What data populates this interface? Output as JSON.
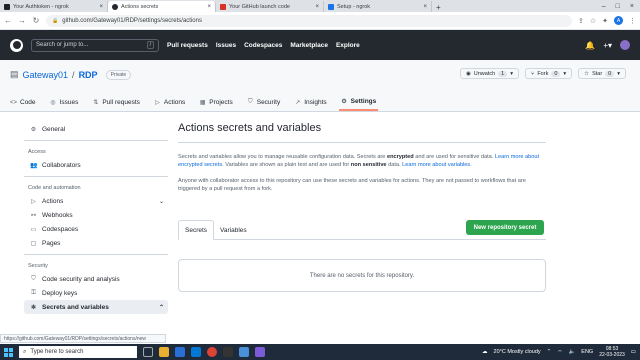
{
  "browser": {
    "tabs": [
      {
        "title": "Your Authtoken - ngrok",
        "color": "#1f2328"
      },
      {
        "title": "Actions secrets",
        "color": "#24292f"
      },
      {
        "title": "Your GitHub launch code",
        "color": "#d93025"
      },
      {
        "title": "Setup - ngrok",
        "color": "#1a73e8"
      }
    ],
    "url": "github.com/Gateway01/RDP/settings/secrets/actions",
    "profile_initial": "A"
  },
  "github": {
    "search_placeholder": "Search or jump to...",
    "search_key": "/",
    "nav": [
      "Pull requests",
      "Issues",
      "Codespaces",
      "Marketplace",
      "Explore"
    ]
  },
  "repo": {
    "owner": "Gateway01",
    "separator": "/",
    "name": "RDP",
    "visibility": "Private",
    "unwatch_label": "Unwatch",
    "unwatch_count": "1",
    "fork_label": "Fork",
    "fork_count": "0",
    "star_label": "Star",
    "star_count": "0",
    "tabs": [
      "Code",
      "Issues",
      "Pull requests",
      "Actions",
      "Projects",
      "Security",
      "Insights",
      "Settings"
    ]
  },
  "sidebar": {
    "general": "General",
    "access_heading": "Access",
    "collaborators": "Collaborators",
    "code_heading": "Code and automation",
    "actions": "Actions",
    "webhooks": "Webhooks",
    "codespaces": "Codespaces",
    "pages": "Pages",
    "security_heading": "Security",
    "code_security": "Code security and analysis",
    "deploy_keys": "Deploy keys",
    "secrets": "Secrets and variables"
  },
  "main": {
    "title": "Actions secrets and variables",
    "desc_part1": "Secrets and variables allow you to manage reusable configuration data. Secrets are ",
    "desc_encrypted": "encrypted",
    "desc_part2": " and are used for sensitive data. ",
    "desc_link1": "Learn more about encrypted secrets",
    "desc_part3": ". Variables are shown as plain text and are used for ",
    "desc_non_sensitive": "non sensitive",
    "desc_part4": " data. ",
    "desc_link2": "Learn more about variables",
    "desc_part5": ".",
    "collab_note": "Anyone with collaborator access to this repository can use these secrets and variables for actions. They are not passed to workflows that are triggered by a pull request from a fork.",
    "new_secret_button": "New repository secret",
    "tab_secrets": "Secrets",
    "tab_variables": "Variables",
    "empty_message": "There are no secrets for this repository."
  },
  "status_url": "https://github.com/Gateway01/RDP/settings/secrets/actions/new",
  "taskbar": {
    "search_placeholder": "Type here to search",
    "weather": "20°C  Mostly cloudy",
    "lang": "ENG",
    "time": "08:53",
    "date": "22-03-2023"
  }
}
